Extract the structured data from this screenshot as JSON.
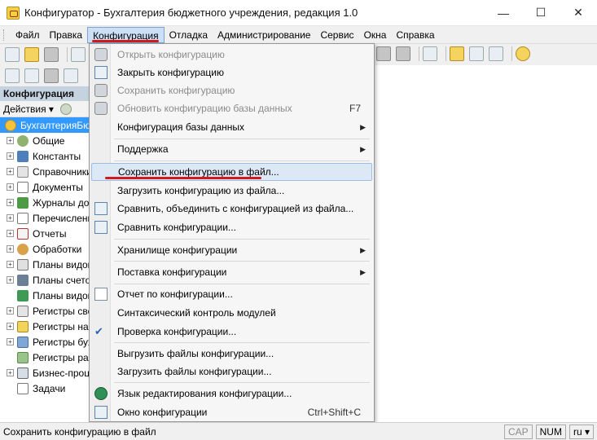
{
  "window": {
    "title": "Конфигуратор - Бухгалтерия бюджетного учреждения, редакция 1.0",
    "minimize": "—",
    "maximize": "☐",
    "close": "✕"
  },
  "menubar": [
    "Файл",
    "Правка",
    "Конфигурация",
    "Отладка",
    "Администрирование",
    "Сервис",
    "Окна",
    "Справка"
  ],
  "panel": {
    "title": "Конфигурация",
    "actions": "Действия ▾",
    "tree": [
      {
        "label": "БухгалтерияБюджетная",
        "icon": "root-icon"
      },
      {
        "label": "Общие",
        "icon": "common-icon"
      },
      {
        "label": "Константы",
        "icon": "constants-icon"
      },
      {
        "label": "Справочники",
        "icon": "catalogs-icon"
      },
      {
        "label": "Документы",
        "icon": "documents-icon"
      },
      {
        "label": "Журналы документов",
        "icon": "journals-icon"
      },
      {
        "label": "Перечисления",
        "icon": "enums-icon"
      },
      {
        "label": "Отчеты",
        "icon": "reports-icon"
      },
      {
        "label": "Обработки",
        "icon": "processing-icon"
      },
      {
        "label": "Планы видов характеристик",
        "icon": "char-plans-icon"
      },
      {
        "label": "Планы счетов",
        "icon": "accounts-icon"
      },
      {
        "label": "Планы видов расчета",
        "icon": "calc-plans-icon"
      },
      {
        "label": "Регистры сведений",
        "icon": "info-registers-icon"
      },
      {
        "label": "Регистры накопления",
        "icon": "accum-registers-icon"
      },
      {
        "label": "Регистры бухгалтерии",
        "icon": "acc-registers-icon"
      },
      {
        "label": "Регистры расчета",
        "icon": "calc-registers-icon"
      },
      {
        "label": "Бизнес-процессы",
        "icon": "bp-icon"
      },
      {
        "label": "Задачи",
        "icon": "tasks-icon"
      }
    ]
  },
  "dropdown": {
    "items": [
      {
        "label": "Открыть конфигурацию",
        "shortcut": "",
        "disabled": true
      },
      {
        "label": "Закрыть конфигурацию",
        "shortcut": "",
        "disabled": false
      },
      {
        "label": "Сохранить конфигурацию",
        "shortcut": "",
        "disabled": true
      },
      {
        "label": "Обновить конфигурацию базы данных",
        "shortcut": "F7",
        "disabled": true
      },
      {
        "label": "Конфигурация базы данных",
        "shortcut": "",
        "submenu": true
      },
      {
        "label": "Поддержка",
        "shortcut": "",
        "submenu": true
      },
      {
        "label": "Сохранить конфигурацию в файл...",
        "shortcut": "",
        "highlighted": true
      },
      {
        "label": "Загрузить конфигурацию из файла...",
        "shortcut": ""
      },
      {
        "label": "Сравнить, объединить с конфигурацией из файла...",
        "shortcut": ""
      },
      {
        "label": "Сравнить конфигурации...",
        "shortcut": ""
      },
      {
        "label": "Хранилище конфигурации",
        "shortcut": "",
        "submenu": true
      },
      {
        "label": "Поставка конфигурации",
        "shortcut": "",
        "submenu": true
      },
      {
        "label": "Отчет по конфигурации...",
        "shortcut": ""
      },
      {
        "label": "Синтаксический контроль модулей",
        "shortcut": ""
      },
      {
        "label": "Проверка конфигурации...",
        "shortcut": ""
      },
      {
        "label": "Выгрузить файлы конфигурации...",
        "shortcut": ""
      },
      {
        "label": "Загрузить файлы конфигурации...",
        "shortcut": ""
      },
      {
        "label": "Язык редактирования конфигурации...",
        "shortcut": ""
      },
      {
        "label": "Окно конфигурации",
        "shortcut": "Ctrl+Shift+C"
      }
    ],
    "submenu_arrow": "▶"
  },
  "status": {
    "text": "Сохранить конфигурацию в файл",
    "cap": "CAP",
    "num": "NUM",
    "lang": "ru ▾"
  },
  "colors": {
    "accent_underline": "#d2191b",
    "selection": "#3399ff",
    "menu_highlight": "#dce8f5"
  }
}
